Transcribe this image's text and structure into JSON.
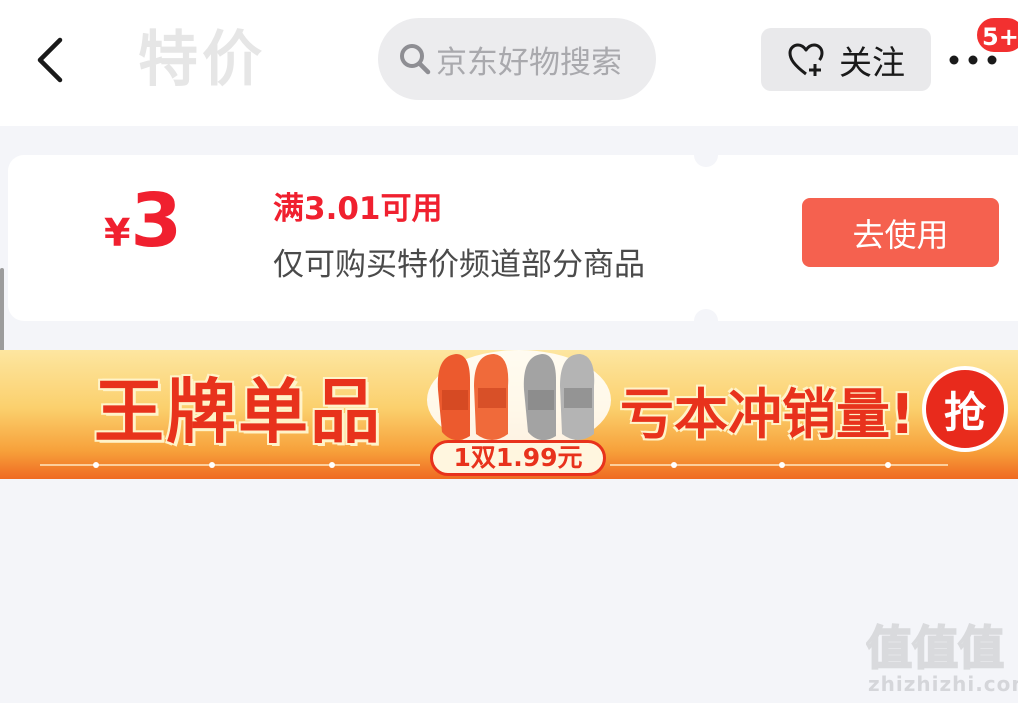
{
  "header": {
    "title": "特价",
    "search_placeholder": "京东好物搜索",
    "follow_label": "关注",
    "notification_badge": "5+"
  },
  "coupon": {
    "currency": "¥",
    "amount": "3",
    "condition": "满3.01可用",
    "description": "仅可购买特价频道部分商品",
    "use_button": "去使用"
  },
  "banner": {
    "left_text": "王牌单品",
    "right_text": "亏本冲销量!",
    "grab_label": "抢",
    "price_tag": "1双1.99元"
  },
  "watermark": {
    "logo_text": "值值值",
    "site": "zhizhizhi.com"
  },
  "colors": {
    "accent_red": "#f0202f",
    "button_orange": "#f5614f",
    "page_bg": "#f4f5f9"
  },
  "icons": [
    "back-arrow-icon",
    "search-icon",
    "heart-plus-icon",
    "more-dots-icon"
  ]
}
